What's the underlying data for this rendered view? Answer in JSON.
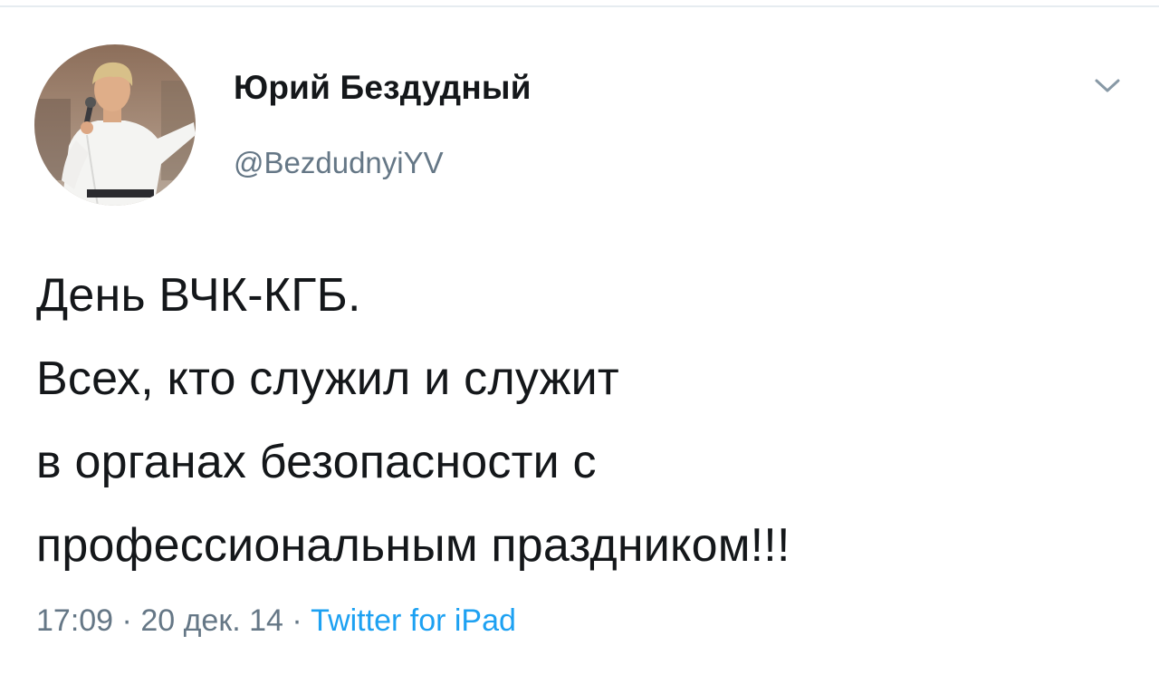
{
  "tweet": {
    "author": {
      "display_name": "Юрий Бездудный",
      "handle": "@BezdudnyiYV"
    },
    "text_lines": [
      "День ВЧК-КГБ.",
      "Всех, кто служил и служит",
      "в органах безопасности с",
      "профессиональным праздником!!!"
    ],
    "time": "17:09",
    "separator": "·",
    "date": "20 дек. 14",
    "source": "Twitter for iPad"
  },
  "icons": {
    "menu": "chevron-down-icon"
  },
  "colors": {
    "text": "#14171a",
    "secondary": "#657786",
    "link": "#1da1f2",
    "divider": "#e6ecf0"
  }
}
